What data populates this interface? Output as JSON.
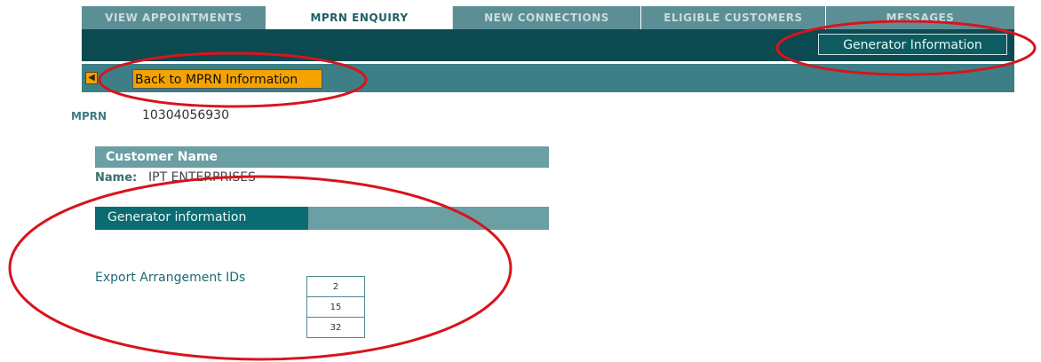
{
  "tabs": [
    {
      "label": "VIEW APPOINTMENTS",
      "active": false
    },
    {
      "label": "MPRN ENQUIRY",
      "active": true
    },
    {
      "label": "NEW CONNECTIONS",
      "active": false
    },
    {
      "label": "ELIGIBLE CUSTOMERS",
      "active": false
    },
    {
      "label": "MESSAGES",
      "active": false
    }
  ],
  "toolbar": {
    "generator_info_button": "Generator Information"
  },
  "subbar": {
    "back_button": "Back to MPRN Information"
  },
  "mprn": {
    "label": "MPRN",
    "value": "10304056930"
  },
  "customer": {
    "header": "Customer Name",
    "name_label": "Name:",
    "name_value": "IPT ENTERPRISES"
  },
  "generator": {
    "header": "Generator information",
    "export_label": "Export Arrangement IDs",
    "export_ids": [
      "2",
      "15",
      "32"
    ]
  },
  "colors": {
    "annotation": "#d8141c",
    "accent": "#0b4a50",
    "back_button": "#f5a300"
  }
}
